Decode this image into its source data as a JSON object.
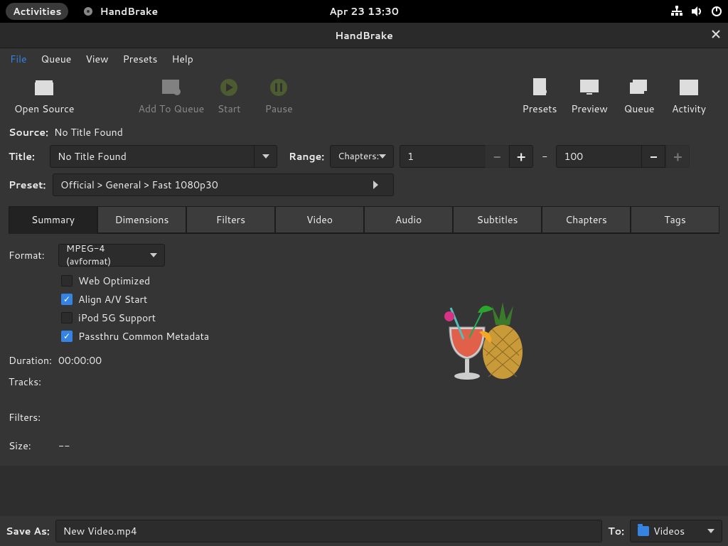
{
  "gnome": {
    "activities": "Activities",
    "app_name": "HandBrake",
    "datetime": "Apr 23  13:30"
  },
  "window": {
    "title": "HandBrake"
  },
  "menubar": [
    "File",
    "Queue",
    "View",
    "Presets",
    "Help"
  ],
  "toolbar": {
    "open_source": "Open Source",
    "add_queue": "Add To Queue",
    "start": "Start",
    "pause": "Pause",
    "presets": "Presets",
    "preview": "Preview",
    "queue": "Queue",
    "activity": "Activity"
  },
  "source": {
    "label": "Source:",
    "value": "No Title Found"
  },
  "title_row": {
    "label": "Title:",
    "value": "No Title Found",
    "range_label": "Range:",
    "range_type": "Chapters:",
    "range_from": "1",
    "range_to": "100"
  },
  "preset_row": {
    "label": "Preset:",
    "value": "Official > General > Fast 1080p30"
  },
  "tabs": [
    "Summary",
    "Dimensions",
    "Filters",
    "Video",
    "Audio",
    "Subtitles",
    "Chapters",
    "Tags"
  ],
  "active_tab": "Summary",
  "summary": {
    "format_label": "Format:",
    "format_value": "MPEG-4 (avformat)",
    "checks": {
      "web_optimized": {
        "label": "Web Optimized",
        "checked": false
      },
      "align_av": {
        "label": "Align A/V Start",
        "checked": true
      },
      "ipod": {
        "label": "iPod 5G Support",
        "checked": false
      },
      "passthru": {
        "label": "Passthru Common Metadata",
        "checked": true
      }
    },
    "duration_label": "Duration:",
    "duration_value": "00:00:00",
    "tracks_label": "Tracks:",
    "tracks_value": "",
    "filters_label": "Filters:",
    "filters_value": "",
    "size_label": "Size:",
    "size_value": "--"
  },
  "bottom": {
    "save_label": "Save As:",
    "save_value": "New Video.mp4",
    "to_label": "To:",
    "dest_value": "Videos"
  }
}
